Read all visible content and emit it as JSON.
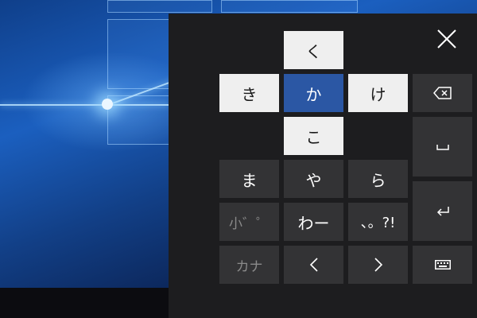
{
  "keyboard": {
    "flick_up": "く",
    "flick_left": "き",
    "center": "か",
    "flick_right": "け",
    "flick_down": "こ",
    "keys": {
      "ma": "ま",
      "ya": "や",
      "ra": "ら",
      "small": "小゛゜",
      "wa": "わー",
      "punct": "、。?!",
      "kana": "カナ",
      "left": "＜",
      "right": "＞"
    }
  },
  "icons": {
    "close": "close-icon",
    "backspace": "backspace-icon",
    "space": "space-icon",
    "enter": "enter-icon",
    "keyboard_switch": "keyboard-icon"
  },
  "colors": {
    "panel": "#1d1d1f",
    "key": "#333335",
    "flick_key": "#efefef",
    "active_key": "#2b57a4"
  }
}
